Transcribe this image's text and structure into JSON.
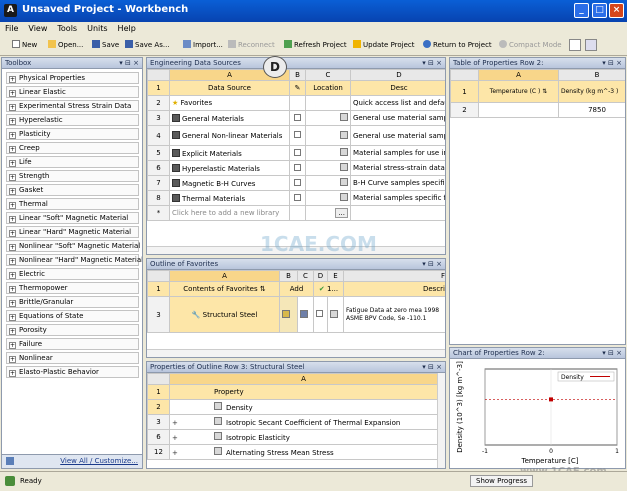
{
  "window": {
    "title": "Unsaved Project - Workbench",
    "app_icon": "A"
  },
  "menu": [
    "File",
    "View",
    "Tools",
    "Units",
    "Help"
  ],
  "toolbar": {
    "new": "New",
    "open": "Open...",
    "save": "Save",
    "save_as": "Save As...",
    "import": "Import...",
    "reconnect": "Reconnect",
    "refresh": "Refresh Project",
    "update": "Update Project",
    "return": "Return to Project",
    "compact": "Compact Mode"
  },
  "toolbox": {
    "title": "Toolbox",
    "items": [
      "Physical Properties",
      "Linear Elastic",
      "Experimental Stress Strain Data",
      "Hyperelastic",
      "Plasticity",
      "Creep",
      "Life",
      "Strength",
      "Gasket",
      "Thermal",
      "Linear \"Soft\" Magnetic Material",
      "Linear \"Hard\" Magnetic Material",
      "Nonlinear \"Soft\" Magnetic Material",
      "Nonlinear \"Hard\" Magnetic Material",
      "Electric",
      "Thermopower",
      "Brittle/Granular",
      "Equations of State",
      "Porosity",
      "Failure",
      "Nonlinear",
      "Elasto-Plastic Behavior"
    ],
    "footer": "View All / Customize..."
  },
  "eds": {
    "title": "Engineering Data Sources",
    "cols": [
      "A",
      "B",
      "C",
      "D"
    ],
    "headers": {
      "a": "Data Source",
      "c": "Location",
      "d": "Desc"
    },
    "rows": [
      {
        "n": "2",
        "a": "Favorites",
        "d": "Quick access list and default"
      },
      {
        "n": "3",
        "a": "General Materials",
        "d": "General use material samples"
      },
      {
        "n": "4",
        "a": "General Non-linear Materials",
        "d": "General use material samples"
      },
      {
        "n": "5",
        "a": "Explicit Materials",
        "d": "Material samples for use in a"
      },
      {
        "n": "6",
        "a": "Hyperelastic Materials",
        "d": "Material stress-strain data s"
      },
      {
        "n": "7",
        "a": "Magnetic B-H Curves",
        "d": "B-H Curve samples specific fo"
      },
      {
        "n": "8",
        "a": "Thermal Materials",
        "d": "Material samples specific for"
      }
    ],
    "add_row": {
      "n": "*",
      "a": "Click here to add a new library",
      "c": "..."
    }
  },
  "marker": "D",
  "outline": {
    "title": "Outline of Favorites",
    "cols": [
      "A",
      "B",
      "C",
      "D",
      "E",
      "F"
    ],
    "headers": {
      "a": "Contents of Favorites",
      "b": "Add",
      "d": "1...",
      "f": "Descri"
    },
    "row3": {
      "n": "3",
      "a": "Structural Steel",
      "f": "Fatigue Data at zero mea 1998 ASME BPV Code, Se -110.1"
    }
  },
  "props": {
    "title": "Properties of Outline Row 3: Structural Steel",
    "cols": [
      "A"
    ],
    "header": "Property",
    "rows": [
      {
        "n": "2",
        "a": "Density",
        "exp": ""
      },
      {
        "n": "3",
        "a": "Isotropic Secant Coefficient of Thermal Expansion",
        "exp": "+"
      },
      {
        "n": "6",
        "a": "Isotropic Elasticity",
        "exp": "+"
      },
      {
        "n": "12",
        "a": "Alternating Stress Mean Stress",
        "exp": "+"
      }
    ]
  },
  "tableprops": {
    "title": "Table of Properties Row 2:",
    "cols": [
      "A",
      "B"
    ],
    "headers": {
      "a": "Temperature (C )",
      "b": "Density (kg m^-3 )"
    },
    "row2": {
      "n": "2",
      "a": "",
      "b": "7850"
    }
  },
  "chart_data": {
    "type": "scatter",
    "title": "Chart of Properties Row 2:",
    "series": [
      {
        "name": "Density",
        "x": [
          0
        ],
        "y": [
          7850
        ]
      }
    ],
    "xlim": [
      -1,
      1
    ],
    "x_ticks": [
      "-1",
      "0",
      "1"
    ],
    "ylabel": "Density (10^3) [kg m^-3]",
    "xlabel": "Temperature [C]",
    "legend_position": "top-right"
  },
  "status": {
    "ready": "Ready",
    "progress": "Show Progress"
  },
  "watermarks": {
    "main": "1CAE.COM",
    "corner": "www.1CAE.com"
  },
  "colors": {
    "accent": "#0a5fd6",
    "header": "#fde6a8",
    "marker_line": "#c00000"
  }
}
